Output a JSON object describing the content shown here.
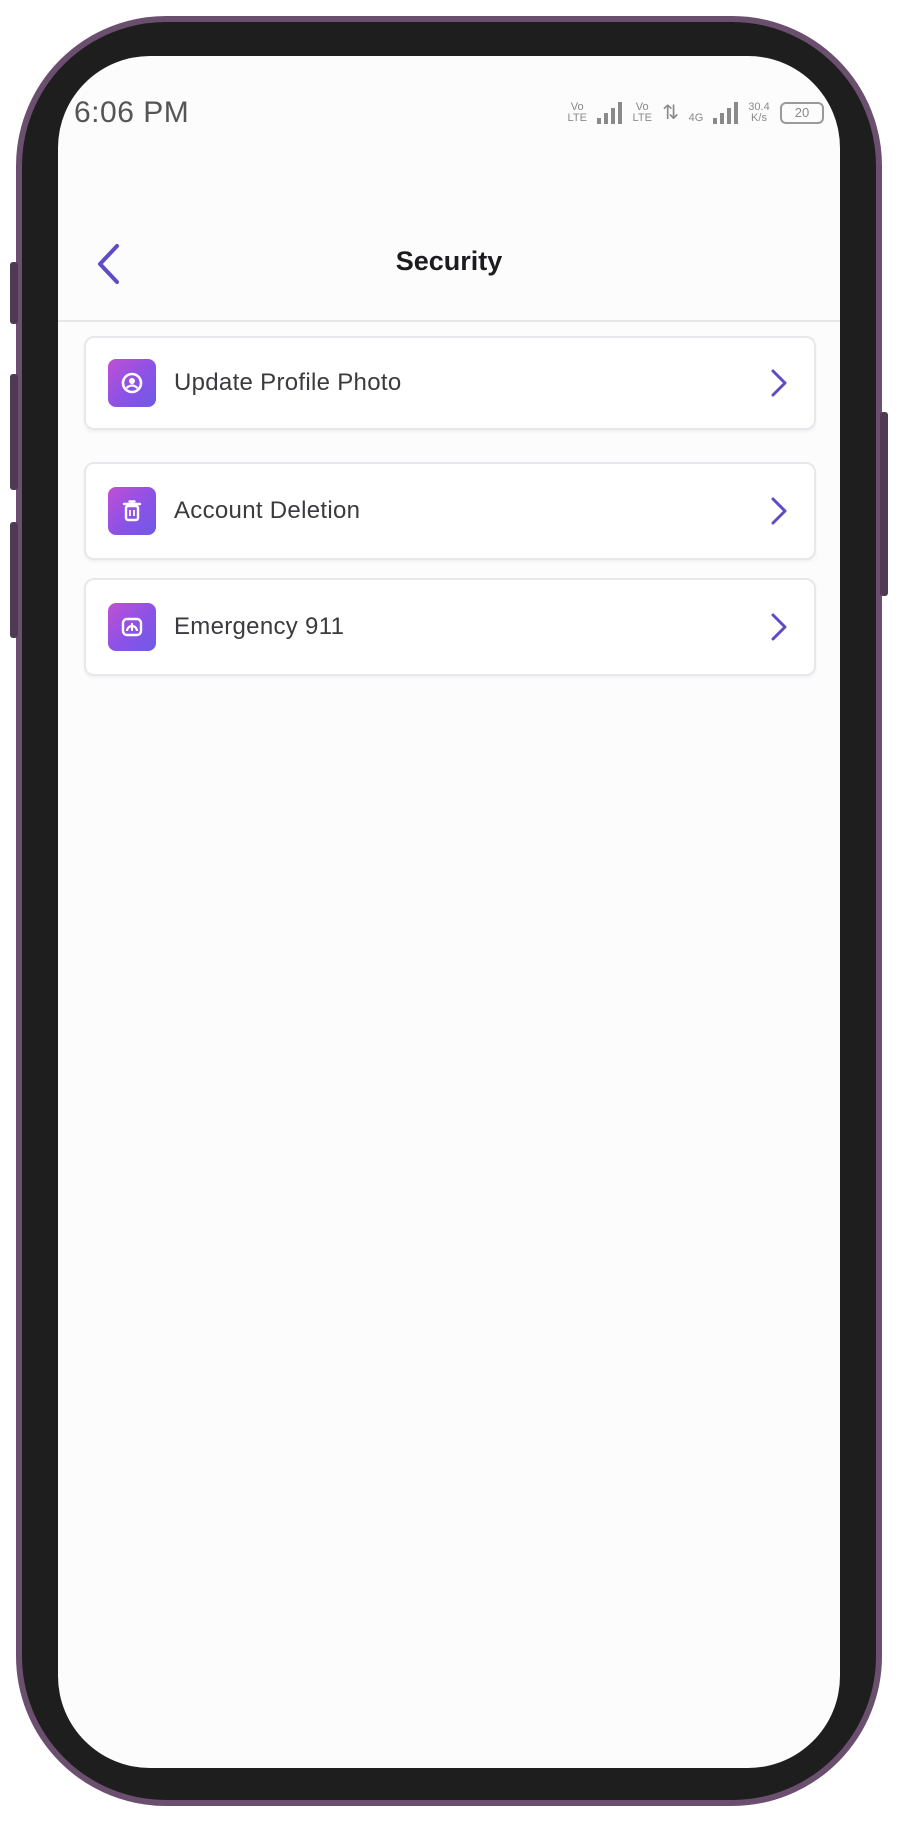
{
  "status_bar": {
    "time": "6:06 PM",
    "sim1": "Vo LTE",
    "sim2": "Vo LTE",
    "network": "4G",
    "speed": "30.4 K/s",
    "battery": "20"
  },
  "header": {
    "title": "Security",
    "back_icon": "chevron-left-icon"
  },
  "menu": {
    "items": [
      {
        "label": "Update Profile Photo",
        "icon": "profile-photo-icon"
      },
      {
        "label": "Account Deletion",
        "icon": "trash-icon"
      },
      {
        "label": "Emergency 911",
        "icon": "emergency-icon"
      }
    ]
  },
  "colors": {
    "accent": "#5e4bc6",
    "icon_gradient_start": "#c04fd6",
    "icon_gradient_end": "#6f5ae8",
    "frame": "#6b4f6e"
  }
}
